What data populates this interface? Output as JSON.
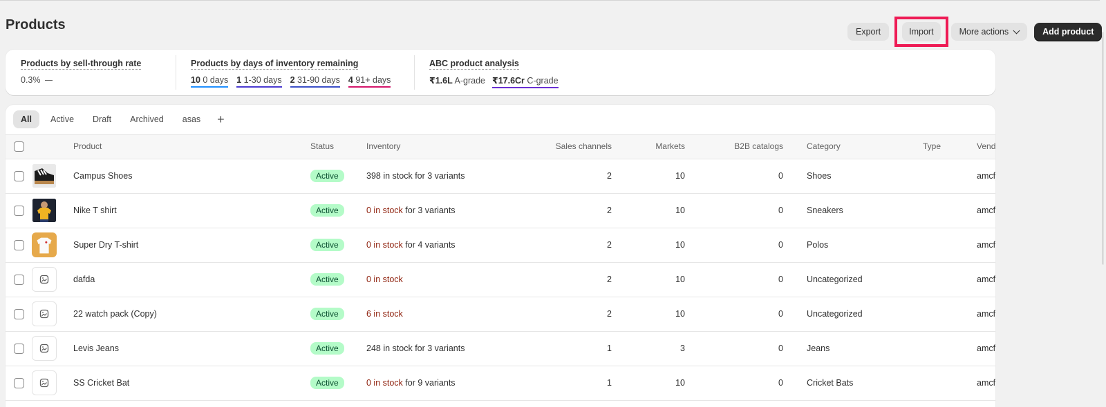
{
  "header": {
    "title": "Products",
    "export_label": "Export",
    "import_label": "Import",
    "more_actions_label": "More actions",
    "add_product_label": "Add product"
  },
  "analytics": {
    "sell_through": {
      "title": "Products by sell-through rate",
      "value": "0.3%"
    },
    "days_inventory": {
      "title": "Products by days of inventory remaining",
      "buckets": [
        {
          "count": "10",
          "label": "0 days"
        },
        {
          "count": "1",
          "label": "1-30 days"
        },
        {
          "count": "2",
          "label": "31-90 days"
        },
        {
          "count": "4",
          "label": "91+ days"
        }
      ]
    },
    "abc": {
      "title": "ABC product analysis",
      "grades": [
        {
          "value": "₹1.6L",
          "label": "A-grade"
        },
        {
          "value": "₹17.6Cr",
          "label": "C-grade"
        }
      ]
    }
  },
  "tabs": [
    "All",
    "Active",
    "Draft",
    "Archived",
    "asas"
  ],
  "table": {
    "columns": [
      "Product",
      "Status",
      "Inventory",
      "Sales channels",
      "Markets",
      "B2B catalogs",
      "Category",
      "Type",
      "Vendor"
    ],
    "rows": [
      {
        "name": "Campus Shoes",
        "status": "Active",
        "inv_stock": "398 in stock",
        "inv_rest": " for 3 variants",
        "inv_red": false,
        "channels": "2",
        "markets": "10",
        "b2b": "0",
        "category": "Shoes",
        "type": "",
        "vendor": "amcf_live",
        "thumb": "shoe"
      },
      {
        "name": "Nike T shirt",
        "status": "Active",
        "inv_stock": "0 in stock",
        "inv_rest": " for 3 variants",
        "inv_red": true,
        "channels": "2",
        "markets": "10",
        "b2b": "0",
        "category": "Sneakers",
        "type": "",
        "vendor": "amcf_live",
        "thumb": "person-yellow"
      },
      {
        "name": "Super Dry T-shirt",
        "status": "Active",
        "inv_stock": "0 in stock",
        "inv_rest": " for 4 variants",
        "inv_red": true,
        "channels": "2",
        "markets": "10",
        "b2b": "0",
        "category": "Polos",
        "type": "",
        "vendor": "amcf_live",
        "thumb": "tshirt-white"
      },
      {
        "name": "dafda",
        "status": "Active",
        "inv_stock": "0 in stock",
        "inv_rest": "",
        "inv_red": true,
        "channels": "2",
        "markets": "10",
        "b2b": "0",
        "category": "Uncategorized",
        "type": "",
        "vendor": "amcf_live",
        "thumb": "placeholder"
      },
      {
        "name": "22 watch pack (Copy)",
        "status": "Active",
        "inv_stock": "6 in stock",
        "inv_rest": "",
        "inv_red": true,
        "channels": "2",
        "markets": "10",
        "b2b": "0",
        "category": "Uncategorized",
        "type": "",
        "vendor": "amcf_live",
        "thumb": "placeholder"
      },
      {
        "name": "Levis Jeans",
        "status": "Active",
        "inv_stock": "248 in stock",
        "inv_rest": " for 3 variants",
        "inv_red": false,
        "channels": "1",
        "markets": "3",
        "b2b": "0",
        "category": "Jeans",
        "type": "",
        "vendor": "amcf_live",
        "thumb": "placeholder"
      },
      {
        "name": "SS Cricket Bat",
        "status": "Active",
        "inv_stock": "0 in stock",
        "inv_rest": " for 9 variants",
        "inv_red": true,
        "channels": "1",
        "markets": "10",
        "b2b": "0",
        "category": "Cricket Bats",
        "type": "",
        "vendor": "amcf_live",
        "thumb": "placeholder"
      }
    ]
  },
  "colors": {
    "highlight_border": "#ee1b55",
    "active_badge_bg": "#b4fbc8",
    "out_of_stock_text": "#8e1f0b",
    "primary_button": "#2b2b2b"
  }
}
